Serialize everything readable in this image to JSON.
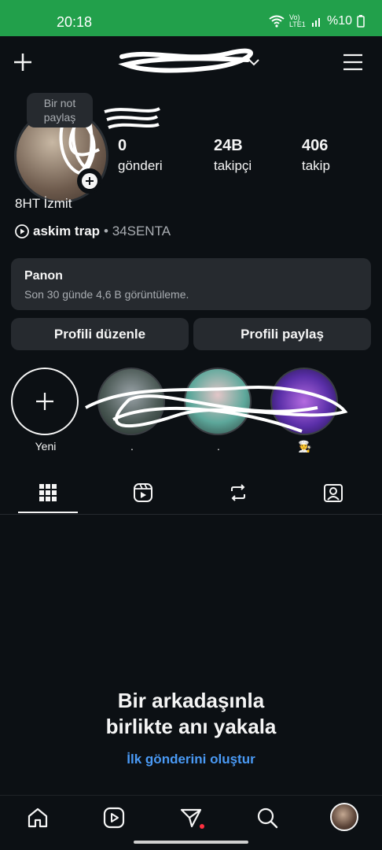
{
  "status_bar": {
    "time": "20:18",
    "network": "Vo) LTE1",
    "battery": "%10"
  },
  "header": {
    "username": ""
  },
  "profile": {
    "tooltip": "Bir not paylaş",
    "display_name": "8HT İzmit",
    "stats": [
      {
        "value": "0",
        "label": "gönderi"
      },
      {
        "value": "24B",
        "label": "takipçi"
      },
      {
        "value": "406",
        "label": "takip"
      }
    ],
    "music": {
      "song": "askim trap",
      "artist": "• 34SENTA"
    }
  },
  "dashboard": {
    "title": "Panon",
    "subtitle": "Son 30 günde 4,6 B görüntüleme."
  },
  "buttons": {
    "edit": "Profili düzenle",
    "share": "Profili paylaş"
  },
  "highlights": [
    {
      "label": "Yeni"
    },
    {
      "label": "."
    },
    {
      "label": "."
    },
    {
      "label": "🧑‍🍳"
    }
  ],
  "tabs": [
    "grid",
    "reels",
    "reposts",
    "tagged"
  ],
  "empty_state": {
    "title_line1": "Bir arkadaşınla",
    "title_line2": "birlikte anı yakala",
    "link": "İlk gönderini oluştur"
  },
  "colors": {
    "background": "#0c1014",
    "status_bar": "#22a04b",
    "card": "#262a2f",
    "link": "#4a9af5"
  }
}
